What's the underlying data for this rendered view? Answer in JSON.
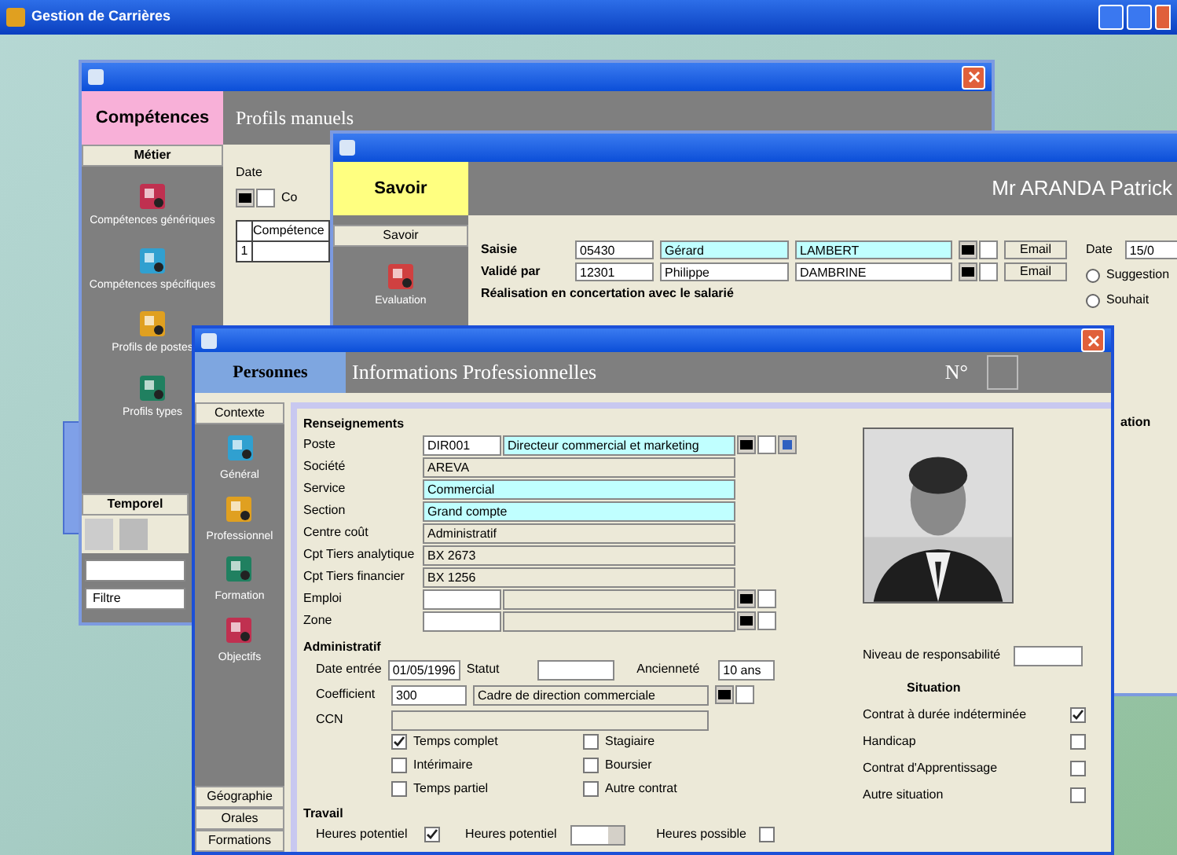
{
  "app_window": {
    "title": "Gestion de Carrières"
  },
  "competences_window": {
    "tab": "Compétences",
    "heading": "Profils manuels",
    "sidebar": {
      "section": "Métier",
      "items": [
        {
          "label": "Compétences génériques"
        },
        {
          "label": "Compétences spécifiques"
        },
        {
          "label": "Profils de postes"
        },
        {
          "label": "Profils types"
        }
      ],
      "bottom_section": "Temporel",
      "filter": "Filtre"
    },
    "panel": {
      "label": "Date",
      "cut_label": "Co",
      "column": "Compétence",
      "row_number": "1"
    }
  },
  "savoir_window": {
    "tab": "Savoir",
    "person": "Mr ARANDA Patrick",
    "sidebar": {
      "section": "Savoir",
      "items": [
        {
          "label": "Evaluation"
        }
      ]
    },
    "rows": [
      {
        "label": "Saisie",
        "code": "05430",
        "first": "Gérard",
        "last": "LAMBERT",
        "action": "Email"
      },
      {
        "label": "Validé par",
        "code": "12301",
        "first": "Philippe",
        "last": "DAMBRINE",
        "action": "Email"
      }
    ],
    "note": "Réalisation en concertation avec le salarié",
    "date_label": "Date",
    "date_value": "15/0",
    "radios": [
      {
        "label": "Suggestion",
        "selected": false
      },
      {
        "label": "Souhait",
        "selected": false
      }
    ],
    "cut_text": "ation"
  },
  "personnes_window": {
    "tab": "Personnes",
    "heading": "Informations Professionnelles",
    "number_label": "N°",
    "sidebar": {
      "section": "Contexte",
      "items": [
        {
          "label": "Général"
        },
        {
          "label": "Professionnel"
        },
        {
          "label": "Formation"
        },
        {
          "label": "Objectifs"
        }
      ],
      "bottom_sections": [
        "Géographie",
        "Orales",
        "Formations"
      ]
    },
    "renseignements": {
      "title": "Renseignements",
      "fields": [
        {
          "kind": "coded",
          "label": "Poste",
          "code": "DIR001",
          "value": "Directeur commercial et marketing",
          "highlight": true
        },
        {
          "kind": "single",
          "label": "Société",
          "value": "AREVA",
          "highlight": false
        },
        {
          "kind": "single",
          "label": "Service",
          "value": "Commercial",
          "highlight": true
        },
        {
          "kind": "single",
          "label": "Section",
          "value": "Grand compte",
          "highlight": true
        },
        {
          "kind": "single",
          "label": "Centre coût",
          "value": "Administratif",
          "highlight": false
        },
        {
          "kind": "single",
          "label": "Cpt Tiers analytique",
          "value": "BX 2673",
          "highlight": false
        },
        {
          "kind": "single",
          "label": "Cpt Tiers financier",
          "value": "BX 1256",
          "highlight": false
        },
        {
          "kind": "coded",
          "label": "Emploi",
          "highlight": false
        },
        {
          "kind": "coded",
          "label": "Zone",
          "highlight": false
        }
      ]
    },
    "administratif": {
      "title": "Administratif",
      "date_label": "Date entrée",
      "date_value": "01/05/1996",
      "statut_label": "Statut",
      "anciennete_label": "Ancienneté",
      "anciennete_value": "10 ans",
      "coefficient_label": "Coefficient",
      "coefficient_code": "300",
      "coefficient_value": "Cadre de direction commerciale",
      "ccn_label": "CCN",
      "contracts": [
        {
          "label": "Temps complet",
          "checked": true
        },
        {
          "label": "Stagiaire",
          "checked": false
        },
        {
          "label": "Intérimaire",
          "checked": false
        },
        {
          "label": "Boursier",
          "checked": false
        },
        {
          "label": "Temps partiel",
          "checked": false
        },
        {
          "label": "Autre contrat",
          "checked": false
        }
      ]
    },
    "responsabilite_label": "Niveau de responsabilité",
    "situation": {
      "title": "Situation",
      "items": [
        {
          "label": "Contrat à durée indéterminée",
          "checked": true
        },
        {
          "label": "Handicap",
          "checked": false
        },
        {
          "label": "Contrat d'Apprentissage",
          "checked": false
        },
        {
          "label": "Autre situation",
          "checked": false
        }
      ]
    },
    "travail": {
      "title": "Travail",
      "heures_label": "Heures potentiel",
      "heures_checked": true,
      "select_label": "Heures potentiel",
      "possible_label": "Heures possible",
      "possible_checked": false
    }
  }
}
